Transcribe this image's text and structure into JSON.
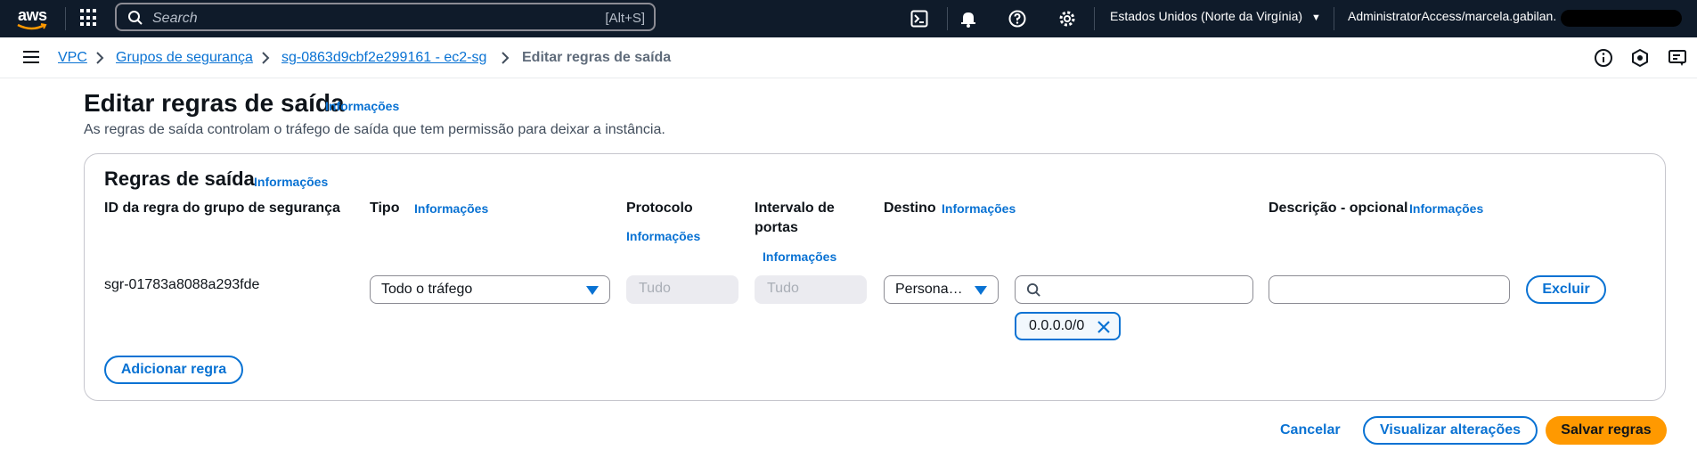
{
  "topnav": {
    "logo": "aws",
    "search_placeholder": "Search",
    "search_shortcut": "[Alt+S]",
    "region": "Estados Unidos (Norte da Virgínia)",
    "account": "AdministratorAccess/marcela.gabilan."
  },
  "breadcrumb": {
    "items": [
      "VPC",
      "Grupos de segurança",
      "sg-0863d9cbf2e299161 - ec2-sg"
    ],
    "current": "Editar regras de saída"
  },
  "page": {
    "title": "Editar regras de saída",
    "info": "Informações",
    "description": "As regras de saída controlam o tráfego de saída que tem permissão para deixar a instância."
  },
  "rules": {
    "title": "Regras de saída",
    "info": "Informações",
    "columns": {
      "rule_id": "ID da regra do grupo de segurança",
      "type": "Tipo",
      "protocol": "Protocolo",
      "port_range_1": "Intervalo de",
      "port_range_2": "portas",
      "destination": "Destino",
      "description": "Descrição - opcional"
    },
    "row": {
      "rule_id": "sgr-01783a8088a293fde",
      "type": "Todo o tráfego",
      "protocol": "Tudo",
      "port_range": "Tudo",
      "destination_type": "Persona…",
      "destination_token": "0.0.0.0/0",
      "delete_label": "Excluir"
    },
    "add_rule": "Adicionar regra"
  },
  "footer": {
    "cancel": "Cancelar",
    "preview": "Visualizar alterações",
    "save": "Salvar regras"
  },
  "colors": {
    "nav_bg": "#0f1b2a",
    "link": "#0972d3",
    "primary": "#ff9900"
  }
}
